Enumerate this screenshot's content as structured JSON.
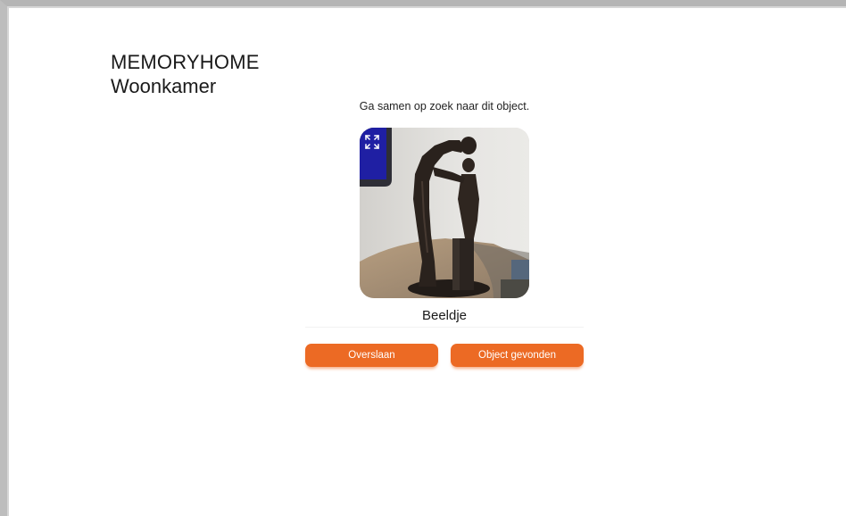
{
  "header": {
    "app_title": "MEMORYHOME",
    "room": "Woonkamer"
  },
  "task": {
    "instruction": "Ga samen op zoek naar dit object.",
    "object_name": "Beeldje",
    "photo_icon": "expand-icon"
  },
  "actions": {
    "skip_label": "Overslaan",
    "found_label": "Object gevonden"
  },
  "colors": {
    "accent": "#ec6a24",
    "text": "#1a1a1a",
    "background": "#ffffff"
  }
}
